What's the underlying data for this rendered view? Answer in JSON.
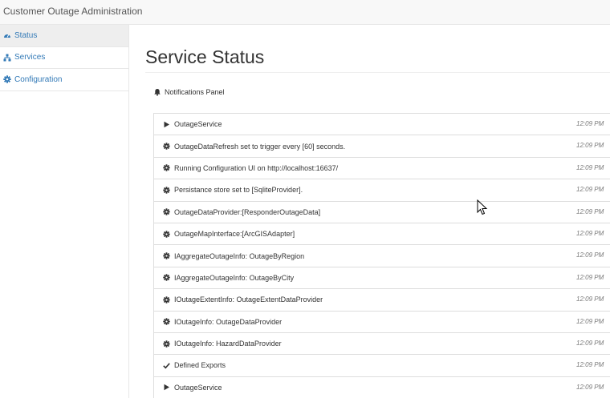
{
  "app": {
    "title": "Customer Outage Administration"
  },
  "sidebar": {
    "items": [
      {
        "label": "Status",
        "icon": "dashboard-icon",
        "active": true
      },
      {
        "label": "Services",
        "icon": "sitemap-icon",
        "active": false
      },
      {
        "label": "Configuration",
        "icon": "gear-icon",
        "active": false
      }
    ]
  },
  "main": {
    "title": "Service Status",
    "panel_title": "Notifications Panel",
    "notifications": [
      {
        "icon": "play-icon",
        "text": "OutageService",
        "time": "12:09 PM"
      },
      {
        "icon": "gear-icon",
        "text": "OutageDataRefresh set to trigger every [60] seconds.",
        "time": "12:09 PM"
      },
      {
        "icon": "gear-icon",
        "text": "Running Configuration UI on http://localhost:16637/",
        "time": "12:09 PM"
      },
      {
        "icon": "gear-icon",
        "text": "Persistance store set to [SqliteProvider].",
        "time": "12:09 PM"
      },
      {
        "icon": "gear-icon",
        "text": "OutageDataProvider:[ResponderOutageData]",
        "time": "12:09 PM"
      },
      {
        "icon": "gear-icon",
        "text": "OutageMapInterface:[ArcGISAdapter]",
        "time": "12:09 PM"
      },
      {
        "icon": "gear-icon",
        "text": "IAggregateOutageInfo: OutageByRegion",
        "time": "12:09 PM"
      },
      {
        "icon": "gear-icon",
        "text": "IAggregateOutageInfo: OutageByCity",
        "time": "12:09 PM"
      },
      {
        "icon": "gear-icon",
        "text": "IOutageExtentInfo: OutageExtentDataProvider",
        "time": "12:09 PM"
      },
      {
        "icon": "gear-icon",
        "text": "IOutageInfo: OutageDataProvider",
        "time": "12:09 PM"
      },
      {
        "icon": "gear-icon",
        "text": "IOutageInfo: HazardDataProvider",
        "time": "12:09 PM"
      },
      {
        "icon": "check-icon",
        "text": "Defined Exports",
        "time": "12:09 PM"
      },
      {
        "icon": "play-icon",
        "text": "OutageService",
        "time": "12:09 PM"
      }
    ]
  }
}
